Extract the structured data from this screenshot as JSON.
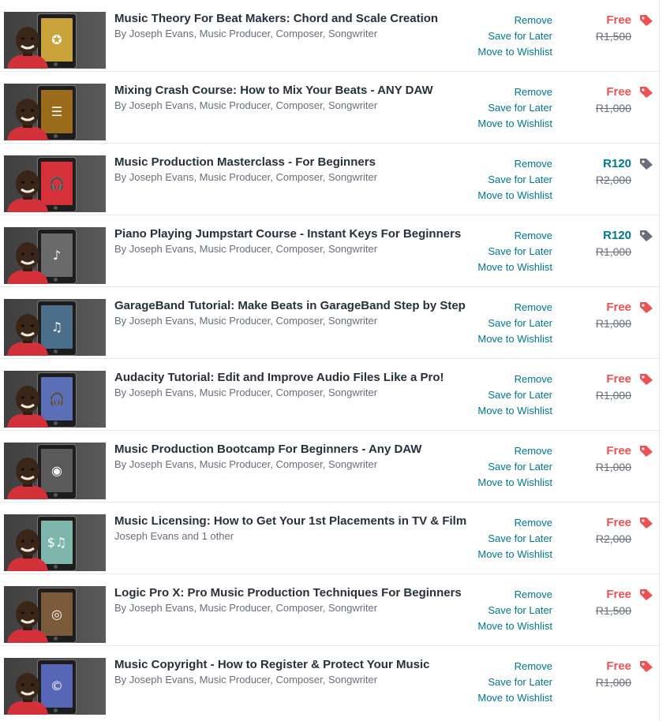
{
  "colors": {
    "link": "#007791",
    "free": "#ec5252",
    "paid": "#007791",
    "tag_free": "#ec5252",
    "tag_paid": "#686f7a"
  },
  "actions": {
    "remove": "Remove",
    "save": "Save for Later",
    "wishlist": "Move to Wishlist"
  },
  "items": [
    {
      "title": "Music Theory For Beat Makers: Chord and Scale Creation",
      "author": "By Joseph Evans, Music Producer, Composer, Songwriter",
      "price": "Free",
      "old_price": "R1,500",
      "price_kind": "free",
      "thumb": "music-theory",
      "screen": "#c9a23a",
      "glyph": "✪"
    },
    {
      "title": "Mixing Crash Course: How to Mix Your Beats - ANY DAW",
      "author": "By Joseph Evans, Music Producer, Composer, Songwriter",
      "price": "Free",
      "old_price": "R1,000",
      "price_kind": "free",
      "thumb": "mixing",
      "screen": "#9a6b1a",
      "glyph": "☰"
    },
    {
      "title": "Music Production Masterclass - For Beginners",
      "author": "By Joseph Evans, Music Producer, Composer, Songwriter",
      "price": "R120",
      "old_price": "R2,000",
      "price_kind": "paid",
      "thumb": "masterclass",
      "screen": "#d6303a",
      "glyph": "🎧"
    },
    {
      "title": "Piano Playing Jumpstart Course - Instant Keys For Beginners",
      "author": "By Joseph Evans, Music Producer, Composer, Songwriter",
      "price": "R120",
      "old_price": "R1,000",
      "price_kind": "paid",
      "thumb": "piano",
      "screen": "#6a6a6a",
      "glyph": "♪"
    },
    {
      "title": "GarageBand Tutorial: Make Beats in GarageBand Step by Step",
      "author": "By Joseph Evans, Music Producer, Composer, Songwriter",
      "price": "Free",
      "old_price": "R1,000",
      "price_kind": "free",
      "thumb": "garageband",
      "screen": "#4b6f8a",
      "glyph": "♫"
    },
    {
      "title": "Audacity Tutorial: Edit and Improve Audio Files Like a Pro!",
      "author": "By Joseph Evans, Music Producer, Composer, Songwriter",
      "price": "Free",
      "old_price": "R1,000",
      "price_kind": "free",
      "thumb": "audacity",
      "screen": "#5b6fb8",
      "glyph": "🎧"
    },
    {
      "title": "Music Production Bootcamp For Beginners - Any DAW",
      "author": "By Joseph Evans, Music Producer, Composer, Songwriter",
      "price": "Free",
      "old_price": "R1,000",
      "price_kind": "free",
      "thumb": "bootcamp",
      "screen": "#5a5a5a",
      "glyph": "◉"
    },
    {
      "title": "Music Licensing: How to Get Your 1st Placements in TV & Film",
      "author": "Joseph Evans and 1 other",
      "price": "Free",
      "old_price": "R2,000",
      "price_kind": "free",
      "thumb": "licensing",
      "screen": "#7fb6ac",
      "glyph": "$♫"
    },
    {
      "title": "Logic Pro X: Pro Music Production Techniques For Beginners",
      "author": "By Joseph Evans, Music Producer, Composer, Songwriter",
      "price": "Free",
      "old_price": "R1,500",
      "price_kind": "free",
      "thumb": "logic",
      "screen": "#7a5a3a",
      "glyph": "◎"
    },
    {
      "title": "Music Copyright - How to Register & Protect Your Music",
      "author": "By Joseph Evans, Music Producer, Composer, Songwriter",
      "price": "Free",
      "old_price": "R1,000",
      "price_kind": "free",
      "thumb": "copyright",
      "screen": "#5866b8",
      "glyph": "©"
    }
  ]
}
